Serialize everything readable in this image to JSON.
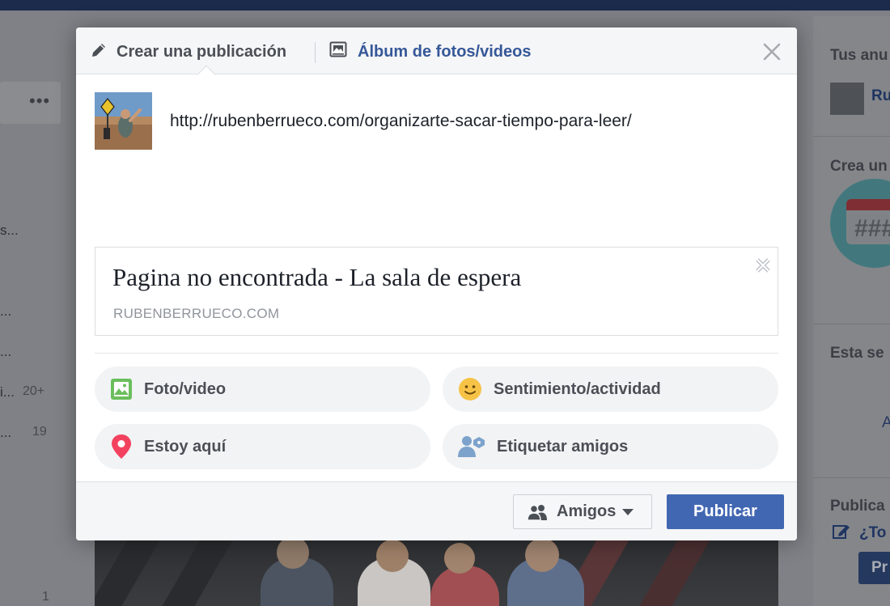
{
  "background": {
    "left_truncated_items": [
      "s...",
      "...",
      "...",
      "i...",
      "..."
    ],
    "left_counts": [
      "20+",
      "19",
      "1"
    ],
    "right_titles": [
      "Tus anu",
      "Crea un",
      "Esta se",
      "Publica"
    ],
    "right_link": "Ru",
    "right_letter": "A",
    "right_question": "¿To",
    "right_button": "Pr",
    "more_dots": "•••",
    "calendar_grid": "###"
  },
  "modal": {
    "tabs": [
      {
        "label": "Crear una publicación",
        "icon": "pencil-icon"
      },
      {
        "label": "Álbum de fotos/videos",
        "icon": "photo-album-icon"
      }
    ],
    "close_icon": "close-icon",
    "post_text": "http://rubenberrueco.com/organizarte-sacar-tiempo-para-leer/",
    "link_preview": {
      "title": "Pagina no encontrada - La sala de espera",
      "domain": "RUBENBERRUECO.COM"
    },
    "actions": [
      {
        "label": "Foto/video",
        "icon": "photo-icon",
        "color": "#6bbe5c"
      },
      {
        "label": "Sentimiento/actividad",
        "icon": "smiley-icon",
        "color": "#f7c347"
      },
      {
        "label": "Estoy aquí",
        "icon": "location-pin-icon",
        "color": "#f3425f"
      },
      {
        "label": "Etiquetar amigos",
        "icon": "tag-friends-icon",
        "color": "#7da3cc"
      }
    ],
    "footer": {
      "audience_label": "Amigos",
      "publish_label": "Publicar"
    }
  },
  "colors": {
    "brand_blue": "#4267b2",
    "link_blue": "#365899",
    "top_bar": "#1c2b4c"
  }
}
